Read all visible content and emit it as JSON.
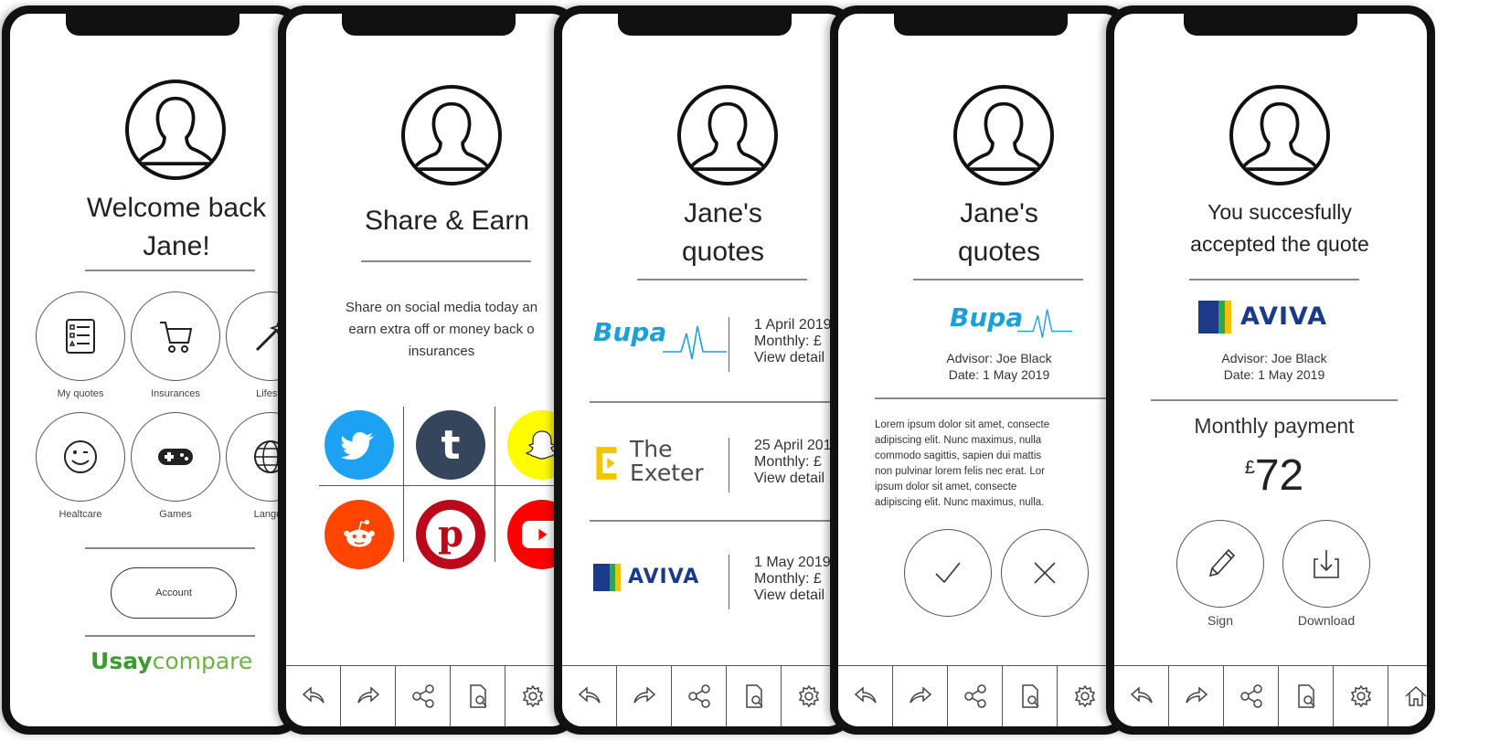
{
  "screens": {
    "welcome": {
      "title_line1": "Welcome back",
      "title_line2": "Jane!",
      "tiles": [
        {
          "label": "My quotes",
          "icon": "list-icon"
        },
        {
          "label": "Insurances",
          "icon": "cart-icon"
        },
        {
          "label": "Lifesty",
          "icon": "magic-wand-icon"
        },
        {
          "label": "Healtcare",
          "icon": "wink-face-icon"
        },
        {
          "label": "Games",
          "icon": "gamepad-icon"
        },
        {
          "label": "Langua",
          "icon": "globe-icon"
        }
      ],
      "account_label": "Account",
      "brand_u": "U",
      "brand_say": "say",
      "brand_compare": "compare"
    },
    "share": {
      "title": "Share & Earn",
      "line1": "Share on social media today an",
      "line2": "earn extra off or money back o",
      "line3": "insurances",
      "social": [
        "twitter-icon",
        "tumblr-icon",
        "snapchat-icon",
        "reddit-icon",
        "pinterest-icon",
        "youtube-icon"
      ]
    },
    "quotes": {
      "title_line1": "Jane's",
      "title_line2": "quotes",
      "rows": [
        {
          "brand": "Bupa",
          "date": "1 April 2019",
          "monthly": "Monthly: £",
          "view": "View detail"
        },
        {
          "brand_line1": "The",
          "brand_line2": "Exeter",
          "date": "25 April 201",
          "monthly": "Monthly: £",
          "view": "View detail"
        },
        {
          "brand": "AVIVA",
          "date": "1 May 2019",
          "monthly": "Monthly: £",
          "view": "View detail"
        }
      ]
    },
    "quote_detail": {
      "title_line1": "Jane's",
      "title_line2": "quotes",
      "brand": "Bupa",
      "advisor": "Advisor: Joe Black",
      "date": "Date: 1 May 2019",
      "lorem": [
        "Lorem ipsum dolor sit amet, consecte",
        "adipiscing elit. Nunc maximus, nulla",
        "commodo sagittis, sapien dui mattis",
        "non pulvinar lorem felis nec erat. Lor",
        "ipsum dolor sit amet, consecte",
        "adipiscing elit. Nunc maximus, nulla."
      ]
    },
    "accepted": {
      "title_line1": "You succesfully",
      "title_line2": "accepted the quote",
      "brand": "AVIVA",
      "advisor": "Advisor: Joe Black",
      "date": "Date: 1 May 2019",
      "payment_label": "Monthly payment",
      "currency": "£",
      "amount": "72",
      "sign_label": "Sign",
      "download_label": "Download"
    }
  },
  "toolbar_icons": [
    "back-arrow-icon",
    "forward-arrow-icon",
    "share-icon",
    "document-search-icon",
    "gear-icon",
    "home-icon"
  ],
  "colors": {
    "bupa": "#1e9fd8",
    "aviva_blue": "#1b3a8a",
    "aviva_green": "#2aa84a",
    "aviva_yellow": "#f2c200",
    "exeter_yellow": "#f5c400",
    "usay_green": "#3d9a2f",
    "compare_green": "#6cb33f",
    "twitter": "#1da1f2",
    "tumblr": "#35465c",
    "snapchat": "#fffc00",
    "reddit": "#ff4500",
    "pinterest": "#bd081c",
    "youtube": "#ff0000"
  }
}
